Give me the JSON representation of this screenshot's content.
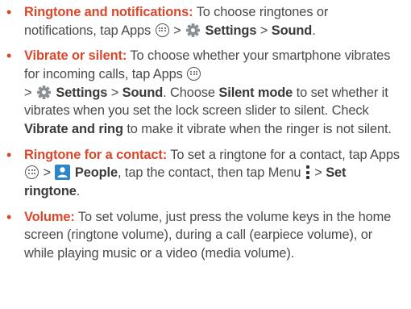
{
  "bullet_char": "•",
  "colors": {
    "heading": "#d9472b",
    "text": "#4a4a4a"
  },
  "icons": [
    "apps-icon",
    "settings-gear-icon",
    "people-icon",
    "menu-icon"
  ],
  "items": [
    {
      "title": "Ringtone and notifications:",
      "t1": " To choose ringtones or notifications, tap Apps ",
      "t2": " > ",
      "ui1": "Settings",
      "t3": " > ",
      "ui2": "Sound",
      "t4": "."
    },
    {
      "title": "Vibrate or silent:",
      "t1": " To choose whether your smartphone vibrates for incoming calls, tap Apps ",
      "t2": " > ",
      "ui1": "Settings",
      "t3": " > ",
      "ui2": "Sound",
      "t4": ". Choose ",
      "ui3": "Silent mode",
      "t5": " to set whether it vibrates when you set the lock screen slider to silent. Check ",
      "ui4": "Vibrate and ring",
      "t6": " to make it vibrate when the ringer is not silent."
    },
    {
      "title": "Ringtone for a contact:",
      "t1": " To set a ringtone for a contact, tap Apps ",
      "t2": " > ",
      "ui1": "People",
      "t3": ", tap the contact, then tap Menu ",
      "t4": " > ",
      "ui2": "Set ringtone",
      "t5": "."
    },
    {
      "title": "Volume:",
      "t1": " To set volume, just press the volume keys in the home screen (ringtone volume), during a call (earpiece volume), or while playing music or a video (media volume)."
    }
  ]
}
